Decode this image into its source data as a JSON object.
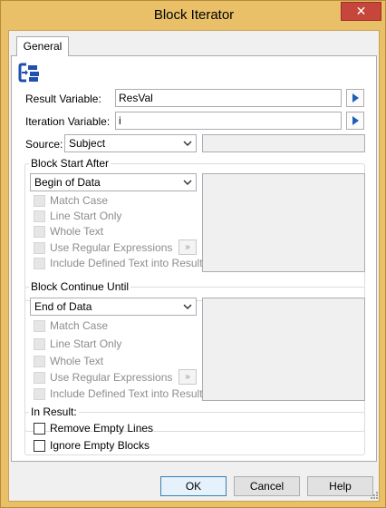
{
  "window": {
    "title": "Block Iterator",
    "close_glyph": "✕"
  },
  "tabs": [
    {
      "label": "General"
    }
  ],
  "icon": "block-iterator-icon",
  "fields": {
    "result_variable": {
      "label": "Result Variable:",
      "value": "ResVal"
    },
    "iteration_variable": {
      "label": "Iteration Variable:",
      "value": "i"
    },
    "source": {
      "label": "Source:",
      "value": "Subject",
      "extra_value": ""
    }
  },
  "block_start": {
    "caption": "Block Start After",
    "selected": "Begin of Data",
    "options": [
      {
        "label": "Match Case",
        "checked": false,
        "enabled": false
      },
      {
        "label": "Line Start Only",
        "checked": false,
        "enabled": false
      },
      {
        "label": "Whole Text",
        "checked": false,
        "enabled": false
      },
      {
        "label": "Use Regular Expressions",
        "checked": false,
        "enabled": false
      },
      {
        "label": "Include Defined Text into Result",
        "checked": false,
        "enabled": false
      }
    ],
    "regex_button": "»"
  },
  "block_continue": {
    "caption": "Block Continue Until",
    "selected": "End of Data",
    "options": [
      {
        "label": "Match Case",
        "checked": false,
        "enabled": false
      },
      {
        "label": "Line Start Only",
        "checked": false,
        "enabled": false
      },
      {
        "label": "Whole Text",
        "checked": false,
        "enabled": false
      },
      {
        "label": "Use Regular Expressions",
        "checked": false,
        "enabled": false
      },
      {
        "label": "Include Defined Text into Result",
        "checked": false,
        "enabled": false
      }
    ],
    "regex_button": "»"
  },
  "in_result": {
    "caption": "In Result:",
    "options": [
      {
        "label": "Remove Empty Lines",
        "checked": false,
        "enabled": true
      },
      {
        "label": "Ignore Empty Blocks",
        "checked": false,
        "enabled": true
      }
    ]
  },
  "buttons": {
    "ok": "OK",
    "cancel": "Cancel",
    "help": "Help"
  },
  "colors": {
    "title_bar": "#e9bf68",
    "close_button": "#c7463c",
    "arrow_button": "#1f5fb5"
  }
}
